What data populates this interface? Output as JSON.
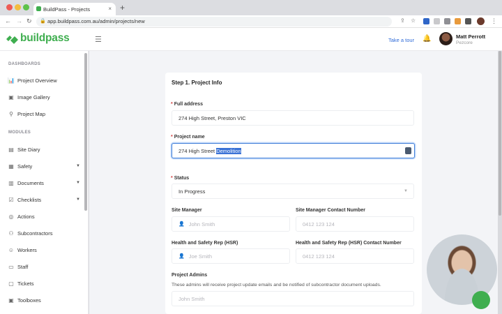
{
  "browser": {
    "tab_title": "BuildPass - Projects",
    "tab_close": "×",
    "new_tab": "+",
    "url": "app.buildpass.com.au/admin/projects/new"
  },
  "header": {
    "logo": "buildpass",
    "take_tour": "Take a tour",
    "user": {
      "name": "Matt Perrott",
      "org": "Pezcore"
    }
  },
  "sidebar": {
    "dashboards_label": "DASHBOARDS",
    "dashboards": [
      {
        "label": "Project Overview",
        "icon": "chart-icon"
      },
      {
        "label": "Image Gallery",
        "icon": "image-icon"
      },
      {
        "label": "Project Map",
        "icon": "pin-icon"
      }
    ],
    "modules_label": "MODULES",
    "modules": [
      {
        "label": "Site Diary",
        "icon": "diary-icon"
      },
      {
        "label": "Safety",
        "icon": "safety-icon"
      },
      {
        "label": "Documents",
        "icon": "document-icon"
      },
      {
        "label": "Checklists",
        "icon": "checklist-icon"
      },
      {
        "label": "Actions",
        "icon": "action-icon"
      },
      {
        "label": "Subcontractors",
        "icon": "group-icon"
      },
      {
        "label": "Workers",
        "icon": "worker-icon"
      },
      {
        "label": "Staff",
        "icon": "staff-icon"
      },
      {
        "label": "Tickets",
        "icon": "ticket-icon"
      },
      {
        "label": "Toolboxes",
        "icon": "toolbox-icon"
      }
    ]
  },
  "form": {
    "step_title": "Step 1. Project Info",
    "required_mark": "*",
    "full_address": {
      "label": "Full address",
      "value": "274 High Street, Preston VIC"
    },
    "project_name": {
      "label": "Project name",
      "value_plain": "274 High Street ",
      "value_selected": "Demolition"
    },
    "status": {
      "label": "Status",
      "value": "In Progress"
    },
    "site_manager": {
      "label": "Site Manager",
      "placeholder": "John Smith"
    },
    "site_manager_contact": {
      "label": "Site Manager Contact Number",
      "placeholder": "0412 123 124"
    },
    "hsr": {
      "label": "Health and Safety Rep (HSR)",
      "placeholder": "Joe Smith"
    },
    "hsr_contact": {
      "label": "Health and Safety Rep (HSR) Contact Number",
      "placeholder": "0412 123 124"
    },
    "project_admins": {
      "label": "Project Admins",
      "helper": "These admins will receive project update emails and be notified of subcontractor document uploads.",
      "placeholder": "John Smith"
    }
  },
  "colors": {
    "brand": "#3fae4f",
    "link": "#2f6bd8",
    "selection": "#3b73d6",
    "required": "#d23c3c"
  }
}
